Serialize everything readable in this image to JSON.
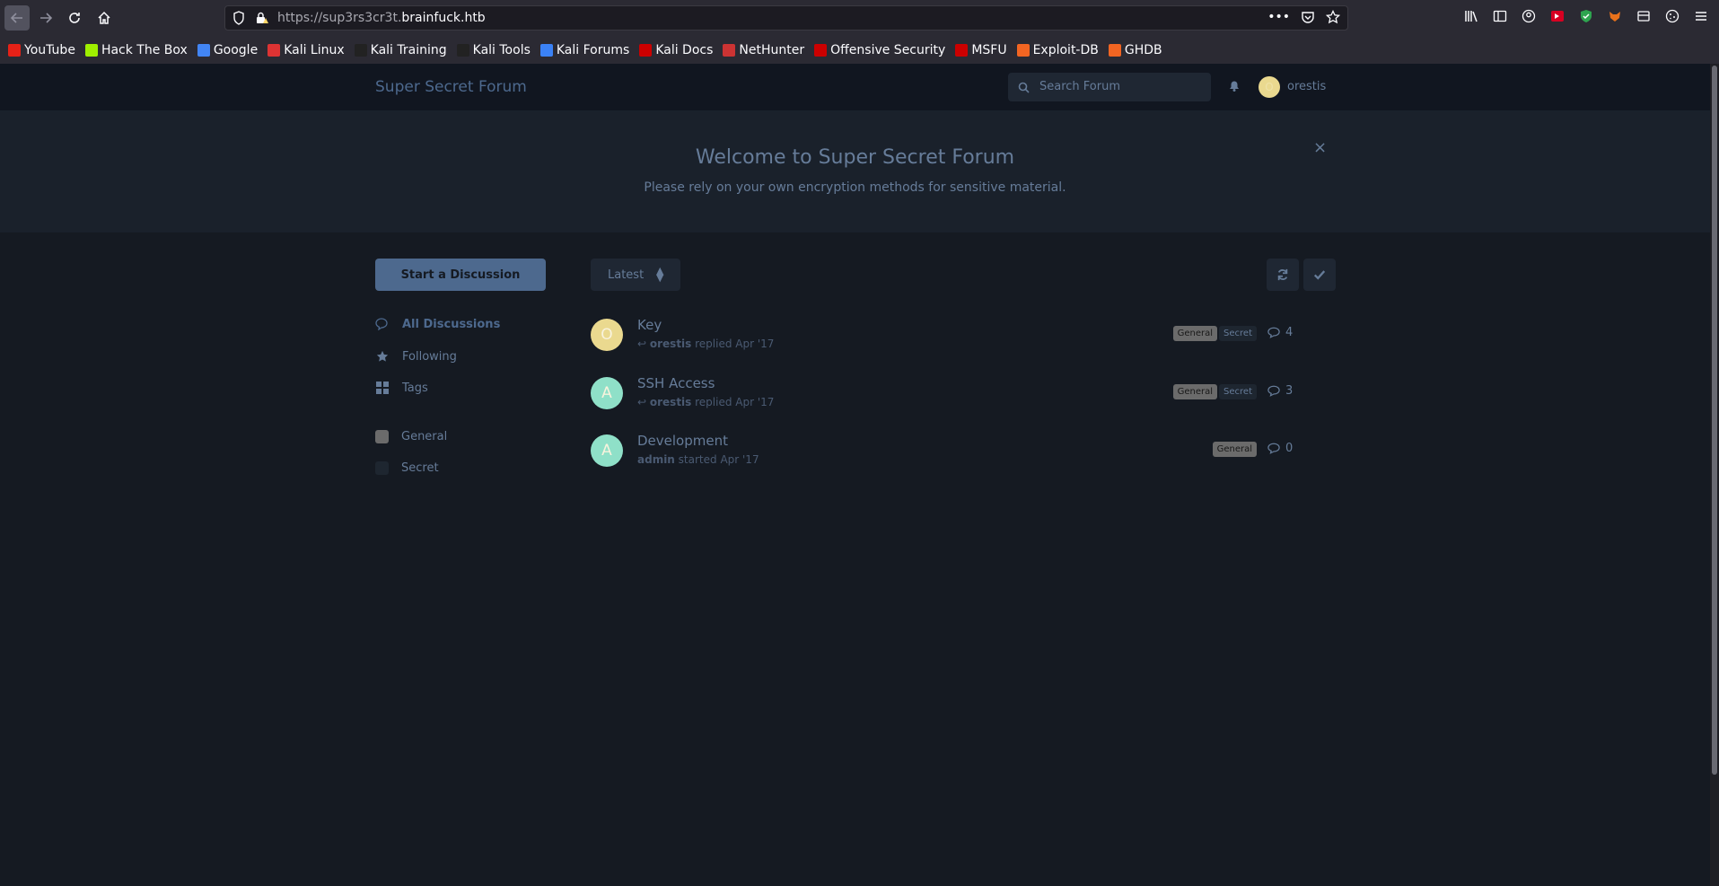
{
  "browser": {
    "url_prefix": "https://sup3rs3cr3t.",
    "url_domain": "brainfuck.htb",
    "bookmarks": [
      {
        "label": "YouTube",
        "color": "#e62117"
      },
      {
        "label": "Hack The Box",
        "color": "#9fef00"
      },
      {
        "label": "Google",
        "color": "#4285f4"
      },
      {
        "label": "Kali Linux",
        "color": "#d33"
      },
      {
        "label": "Kali Training",
        "color": "#222"
      },
      {
        "label": "Kali Tools",
        "color": "#222"
      },
      {
        "label": "Kali Forums",
        "color": "#3b82f6"
      },
      {
        "label": "Kali Docs",
        "color": "#c00"
      },
      {
        "label": "NetHunter",
        "color": "#c33"
      },
      {
        "label": "Offensive Security",
        "color": "#c00"
      },
      {
        "label": "MSFU",
        "color": "#c00"
      },
      {
        "label": "Exploit-DB",
        "color": "#f26522"
      },
      {
        "label": "GHDB",
        "color": "#f26522"
      }
    ]
  },
  "header": {
    "site_title": "Super Secret Forum",
    "search_placeholder": "Search Forum",
    "user_initial": "O",
    "username": "orestis"
  },
  "hero": {
    "title": "Welcome to Super Secret Forum",
    "description": "Please rely on your own encryption methods for sensitive material.",
    "close_icon": "×"
  },
  "sidebar": {
    "start_label": "Start a Discussion",
    "nav": [
      {
        "label": "All Discussions",
        "icon": "comments-icon",
        "active": true
      },
      {
        "label": "Following",
        "icon": "star-icon",
        "active": false
      },
      {
        "label": "Tags",
        "icon": "grid-icon",
        "active": false
      }
    ],
    "tags": [
      {
        "label": "General",
        "color": "#6b6b6b"
      },
      {
        "label": "Secret",
        "color": "#1e2630"
      }
    ]
  },
  "toolbar": {
    "sort_label": "Latest"
  },
  "discussions": [
    {
      "title": "Key",
      "avatar_letter": "O",
      "avatar_color": "#ead98f",
      "user": "orestis",
      "action": " replied Apr '17",
      "reply": true,
      "tags": [
        "General",
        "Secret"
      ],
      "count": "4"
    },
    {
      "title": "SSH Access",
      "avatar_letter": "A",
      "avatar_color": "#8fe0c8",
      "user": "orestis",
      "action": " replied Apr '17",
      "reply": true,
      "tags": [
        "General",
        "Secret"
      ],
      "count": "3"
    },
    {
      "title": "Development",
      "avatar_letter": "A",
      "avatar_color": "#8fe0c8",
      "user": "admin",
      "action": " started Apr '17",
      "reply": false,
      "tags": [
        "General"
      ],
      "count": "0"
    }
  ]
}
